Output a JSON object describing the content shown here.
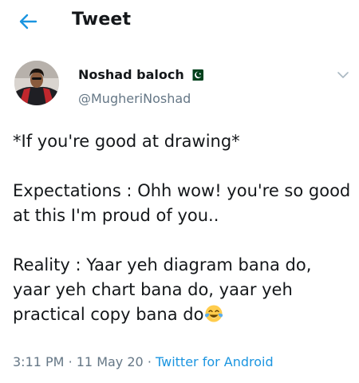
{
  "header": {
    "title": "Tweet",
    "back_icon": "arrow-left-icon",
    "accent_color": "#1b95e0"
  },
  "tweet": {
    "author": {
      "name": "Noshad baloch",
      "handle": "@MugheriNoshad",
      "flag_icon": "pakistan-flag-icon"
    },
    "text": {
      "line1": "*If you're good at drawing*",
      "expectations": "Expectations : Ohh wow! you're so good at this I'm proud of you..",
      "reality": "Reality : Yaar yeh diagram bana do, yaar yeh chart bana do, yaar yeh practical copy bana do",
      "reality_emoji": "face-with-tears-of-joy-icon"
    },
    "meta": {
      "time": "3:11 PM",
      "date": "11 May 20",
      "separator": "·",
      "source": "Twitter for Android"
    }
  }
}
